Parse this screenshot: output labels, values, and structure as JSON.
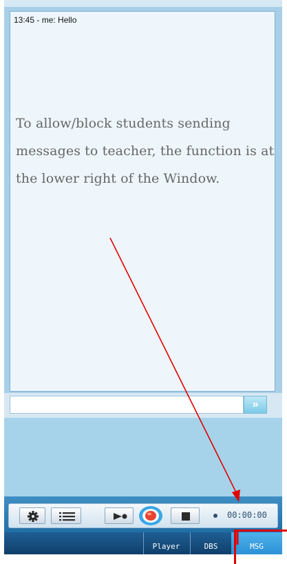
{
  "chat": {
    "messages": [
      {
        "text": "13:45 - me: Hello"
      }
    ]
  },
  "annotation": {
    "text": "To allow/block students sending messages to teacher, the function is at the lower right of the Window."
  },
  "input": {
    "value": "",
    "placeholder": ""
  },
  "send": {
    "label": "»"
  },
  "controls": {
    "timer": "00:00:00",
    "icons": [
      "gear-icon",
      "list-icon",
      "play-icon",
      "record-icon",
      "stop-icon"
    ]
  },
  "tabs": [
    {
      "label": "Player"
    },
    {
      "label": "DBS"
    },
    {
      "label": "MSG",
      "active": true
    }
  ],
  "colors": {
    "annotation_arrow": "#e00000",
    "active_tab": "#2c92d6",
    "tab_bar": "#0f3e6a"
  }
}
